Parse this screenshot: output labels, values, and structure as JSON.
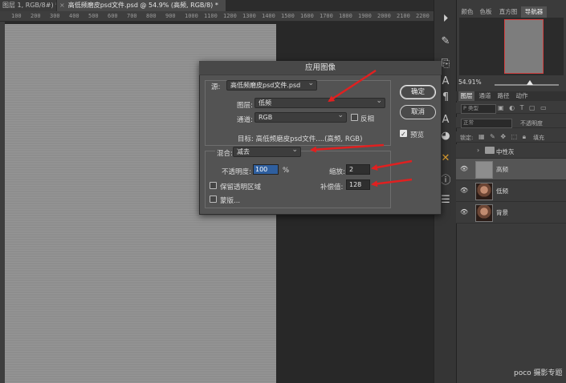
{
  "document_tabs": [
    {
      "label": "图层 1, RGB/8#) *"
    },
    {
      "label": "高低频磨皮psd文件.psd @ 54.9% (高频, RGB/8) *"
    }
  ],
  "ruler_ticks": [
    "100",
    "200",
    "300",
    "400",
    "500",
    "600",
    "700",
    "800",
    "900",
    "1000",
    "1100",
    "1200",
    "1300",
    "1400",
    "1500",
    "1600",
    "1700",
    "1800",
    "1900",
    "2000",
    "2100",
    "2200"
  ],
  "navigator": {
    "tabs": [
      "颜色",
      "色板",
      "直方图",
      "导航器"
    ],
    "active_tab": "导航器",
    "zoom_text": "54.91%",
    "zoom_fraction": 0.55
  },
  "layers_panel": {
    "tabs": [
      "图层",
      "通道",
      "路径",
      "动作"
    ],
    "active_tab": "图层",
    "kind_filter": "P 类型",
    "blend_mode": "正常",
    "opacity_label": "不透明度",
    "lock_label": "锁定:",
    "fill_label": "填充",
    "layers": [
      {
        "name": "中性灰",
        "type": "group",
        "visible": false,
        "selected": false
      },
      {
        "name": "高频",
        "type": "layer",
        "visible": true,
        "selected": true
      },
      {
        "name": "低频",
        "type": "layer",
        "visible": true,
        "selected": false
      },
      {
        "name": "背景",
        "type": "layer",
        "visible": true,
        "selected": false
      }
    ]
  },
  "dialog": {
    "title": "应用图像",
    "source_label": "源:",
    "source_value": "高低频磨皮psd文件.psd",
    "layer_label": "图层:",
    "layer_value": "低频",
    "channel_label": "通道:",
    "channel_value": "RGB",
    "invert_label": "反相",
    "invert_checked": false,
    "target_text": "目标:  高低频磨皮psd文件....(高频, RGB)",
    "blending_label": "混合:",
    "blending_value": "减去",
    "opacity_label": "不透明度:",
    "opacity_value": "100",
    "opacity_unit": "%",
    "scale_label": "缩放:",
    "scale_value": "2",
    "offset_label": "补偿值:",
    "offset_value": "128",
    "preserve_label": "保留透明区域",
    "preserve_checked": false,
    "mask_label": "蒙版...",
    "mask_checked": false,
    "ok_label": "确定",
    "cancel_label": "取消",
    "preview_label": "预览",
    "preview_checked": true
  },
  "watermark": "poco 摄影专题",
  "colors": {
    "arrow": "#e02020",
    "nav_view_box": "#d34040",
    "opacity_highlight": "#2f5f9f"
  }
}
